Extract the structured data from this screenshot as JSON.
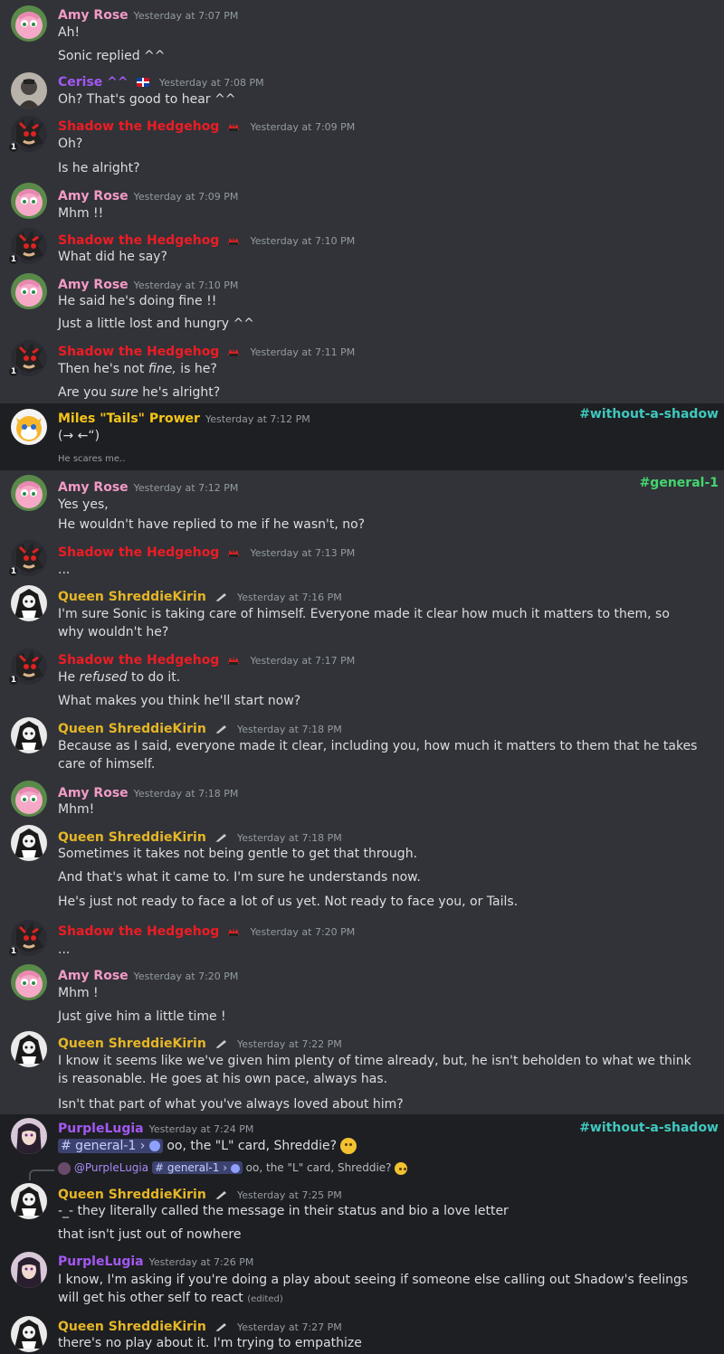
{
  "colors": {
    "amy": "#f39ac6",
    "cerise": "#a358f2",
    "shadow": "#ed1c24",
    "tails": "#f5c518",
    "queen": "#e6b626",
    "purple": "#a358f2",
    "channel_cyan": "#3fc9c0",
    "channel_green": "#43d66f"
  },
  "channels": {
    "without_a_shadow": "#without-a-shadow",
    "general_1": "#general-1"
  },
  "messages": [
    {
      "name": "Amy Rose",
      "ts": "Yesterday at 7:07 PM",
      "lines": [
        "Ah!",
        "Sonic replied ^^"
      ]
    },
    {
      "name": "Cerise ^^",
      "ts": "Yesterday at 7:08 PM",
      "lines": [
        "Oh? That's good to hear ^^"
      ]
    },
    {
      "name": "Shadow the Hedgehog",
      "ts": "Yesterday at 7:09 PM",
      "lines": [
        "Oh?",
        "Is he alright?"
      ]
    },
    {
      "name": "Amy Rose",
      "ts": "Yesterday at 7:09 PM",
      "lines": [
        "Mhm !!"
      ]
    },
    {
      "name": "Shadow the Hedgehog",
      "ts": "Yesterday at 7:10 PM",
      "lines": [
        "What did he say?"
      ]
    },
    {
      "name": "Amy Rose",
      "ts": "Yesterday at 7:10 PM",
      "lines": [
        "He said he's doing fine !!",
        "Just a little lost and hungry ^^"
      ]
    },
    {
      "name": "Shadow the Hedgehog",
      "ts": "Yesterday at 7:11 PM",
      "lines": [
        "Then he's not ",
        "fine,",
        " is he?",
        "Are you ",
        "sure",
        " he's alright?"
      ]
    },
    {
      "name": "Miles \"Tails\" Prower",
      "ts": "Yesterday at 7:12 PM",
      "lines": [
        "(→ ←“)",
        "He scares me.."
      ]
    },
    {
      "name": "Amy Rose",
      "ts": "Yesterday at 7:12 PM",
      "lines": [
        "Yes yes,",
        "He wouldn't have replied to me if he wasn't, no?"
      ]
    },
    {
      "name": "Shadow the Hedgehog",
      "ts": "Yesterday at 7:13 PM",
      "lines": [
        "..."
      ]
    },
    {
      "name": "Queen ShreddieKirin",
      "ts": "Yesterday at 7:16 PM",
      "lines": [
        "I'm sure Sonic is taking care of himself. Everyone made it clear how much it matters to them, so why wouldn't he?"
      ]
    },
    {
      "name": "Shadow the Hedgehog",
      "ts": "Yesterday at 7:17 PM",
      "lines": [
        "He ",
        "refused",
        " to do it.",
        "What makes you think he'll start now?"
      ]
    },
    {
      "name": "Queen ShreddieKirin",
      "ts": "Yesterday at 7:18 PM",
      "lines": [
        "Because as I said, everyone made it clear, including you, how much it matters to them that he takes care of himself."
      ]
    },
    {
      "name": "Amy Rose",
      "ts": "Yesterday at 7:18 PM",
      "lines": [
        "Mhm!"
      ]
    },
    {
      "name": "Queen ShreddieKirin",
      "ts": "Yesterday at 7:18 PM",
      "lines": [
        "Sometimes it takes not being gentle to get that through.",
        "And that's what it came to. I'm sure he understands now.",
        "He's just not ready to face a lot of us yet. Not ready to face you, or Tails."
      ]
    },
    {
      "name": "Shadow the Hedgehog",
      "ts": "Yesterday at 7:20 PM",
      "lines": [
        "..."
      ]
    },
    {
      "name": "Amy Rose",
      "ts": "Yesterday at 7:20 PM",
      "lines": [
        "Mhm !",
        "Just give him a little time !"
      ]
    },
    {
      "name": "Queen ShreddieKirin",
      "ts": "Yesterday at 7:22 PM",
      "lines": [
        "I know it seems like we've given him plenty of time already, but, he isn't beholden to what we think is reasonable. He goes at his own pace, always has.",
        "Isn't that part of what you've always loved about him?"
      ]
    },
    {
      "name": "PurpleLugia",
      "ts": "Yesterday at 7:24 PM",
      "lines": [
        "# general-1 ›",
        "oo, the \"L\" card, Shreddie?"
      ]
    },
    {
      "reply_user": "@PurpleLugia",
      "reply_text": "oo, the \"L\" card, Shreddie?",
      "name": "Queen ShreddieKirin",
      "ts": "Yesterday at 7:25 PM",
      "lines": [
        "-_- they literally called the message in their status and bio a love letter",
        "that isn't just out of nowhere"
      ]
    },
    {
      "name": "PurpleLugia",
      "ts": "Yesterday at 7:26 PM",
      "lines": [
        "I know, I'm asking if you're doing a play about seeing if someone else calling out Shadow's feelings will get his other self to react",
        "(edited)"
      ]
    },
    {
      "name": "Queen ShreddieKirin",
      "ts": "Yesterday at 7:27 PM",
      "lines": [
        "there's no play about it. I'm trying to empathize"
      ]
    }
  ]
}
